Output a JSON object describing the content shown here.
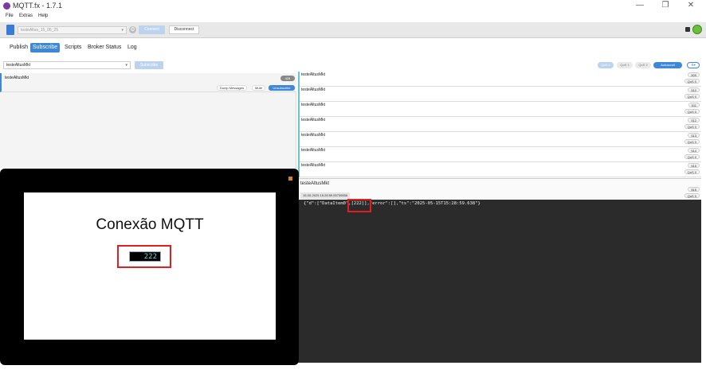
{
  "window": {
    "title": "MQTT.fx - 1.7.1",
    "controls": {
      "minimize": "—",
      "maximize": "❐",
      "close": "✕"
    }
  },
  "menu": {
    "items": [
      "File",
      "Extras",
      "Help"
    ]
  },
  "connection": {
    "profile_value": "testeAltus_15_05_25",
    "gear_label": "⚙",
    "connect_label": "Connect",
    "disconnect_label": "Disconnect",
    "status_color": "#6bbf3a"
  },
  "tabs": [
    "Publish",
    "Subscribe",
    "Scripts",
    "Broker Status",
    "Log"
  ],
  "subscribe": {
    "topic_value": "testeAltusMkt",
    "subscribe_label": "Subscribe",
    "qos_buttons": [
      "QoS 0",
      "QoS 1",
      "QoS 2"
    ],
    "autoscroll_label": "Autoscroll",
    "more_label": "⚙▾"
  },
  "subscription": {
    "topic": "testeAltusMkt",
    "count": "428",
    "buttons": [
      "Dump Messages",
      "Mute",
      "Unsubscribe"
    ]
  },
  "messages": [
    {
      "topic": "testeAltusMkt",
      "num": "509",
      "qos": "QoS 0"
    },
    {
      "topic": "testeAltusMkt",
      "num": "510",
      "qos": "QoS 0"
    },
    {
      "topic": "testeAltusMkt",
      "num": "511",
      "qos": "QoS 0"
    },
    {
      "topic": "testeAltusMkt",
      "num": "512",
      "qos": "QoS 0"
    },
    {
      "topic": "testeAltusMkt",
      "num": "513",
      "qos": "QoS 0"
    },
    {
      "topic": "testeAltusMkt",
      "num": "514",
      "qos": "QoS 0"
    },
    {
      "topic": "testeAltusMkt",
      "num": "515",
      "qos": "QoS 0"
    }
  ],
  "detail": {
    "topic": "testeAltusMkt",
    "timestamp": "15-05-2025  15:28:59.55739856",
    "num": "515",
    "qos": "QoS 0",
    "payload": "{\"d\":[\"DataItem0\",[222]],\"error\":[],\"ts\":\"2025-05-15T15:28:59.638\"}"
  },
  "hmi": {
    "title": "Conexão MQTT",
    "value": "222"
  },
  "colors": {
    "accent": "#3e88d8",
    "highlight": "#e02020",
    "payload_bg": "#2b2b2b"
  }
}
